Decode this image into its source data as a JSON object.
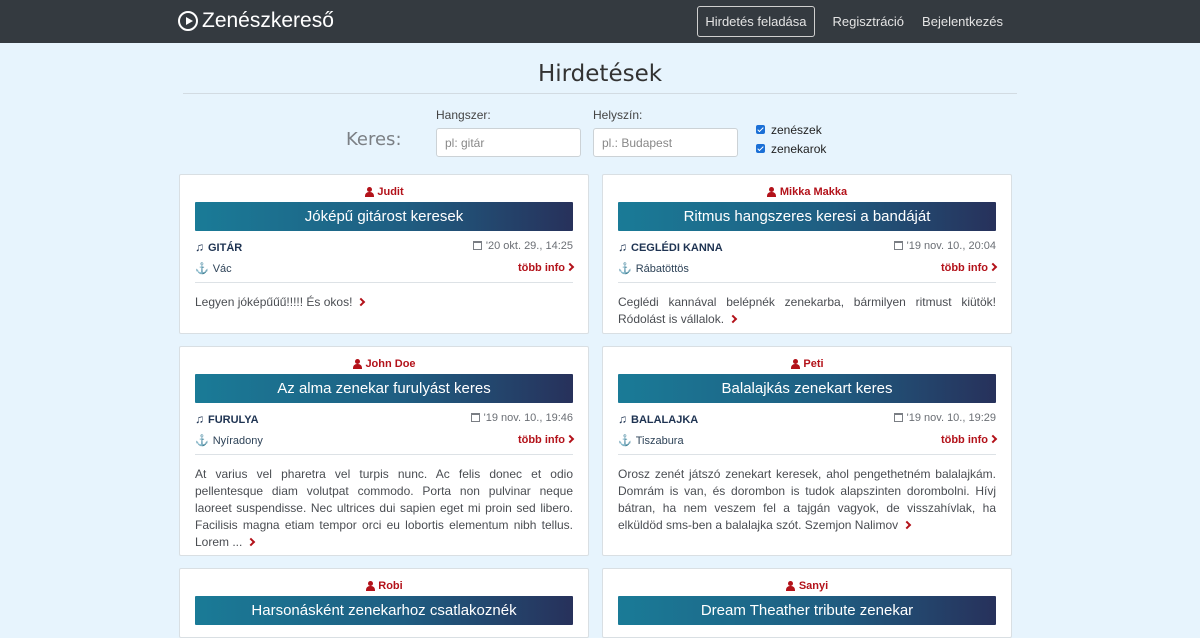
{
  "navbar": {
    "brand": "Zenészkereső",
    "links": [
      "Hirdetés feladása",
      "Regisztráció",
      "Bejelentkezés"
    ]
  },
  "page_title": "Hirdetések",
  "search": {
    "lead": "Keres:",
    "instrument_label": "Hangszer:",
    "instrument_placeholder": "pl: gitár",
    "location_label": "Helyszín:",
    "location_placeholder": "pl.: Budapest",
    "checkbox_musicians": "zenészek",
    "checkbox_bands": "zenekarok"
  },
  "cards": [
    {
      "author": "Judit",
      "title": "Jóképű gitárost keresek",
      "instrument": "GITÁR",
      "date": "'20 okt. 29., 14:25",
      "location": "Vác",
      "more": "több info",
      "description": "Legyen jóképűűű!!!!! És okos!"
    },
    {
      "author": "Mikka Makka",
      "title": "Ritmus hangszeres keresi a bandáját",
      "instrument": "CEGLÉDI KANNA",
      "date": "'19 nov. 10., 20:04",
      "location": "Rábatöttös",
      "more": "több info",
      "description": "Ceglédi kannával belépnék zenekarba, bármilyen ritmust kiütök! Ródolást is vállalok."
    },
    {
      "author": "John Doe",
      "title": "Az alma zenekar furulyást keres",
      "instrument": "FURULYA",
      "date": "'19 nov. 10., 19:46",
      "location": "Nyíradony",
      "more": "több info",
      "description": "At varius vel pharetra vel turpis nunc. Ac felis donec et odio pellentesque diam volutpat commodo. Porta non pulvinar neque laoreet suspendisse. Nec ultrices dui sapien eget mi proin sed libero. Facilisis magna etiam tempor orci eu lobortis elementum nibh tellus. Lorem ..."
    },
    {
      "author": "Peti",
      "title": "Balalajkás zenekart keres",
      "instrument": "BALALAJKA",
      "date": "'19 nov. 10., 19:29",
      "location": "Tiszabura",
      "more": "több info",
      "description": "Orosz zenét játszó zenekart keresek, ahol pengethetném balalajkám. Domrám is van, és dorombon is tudok alapszinten dorombolni. Hívj bátran, ha nem veszem fel a tajgán vagyok, de visszahívlak, ha elküldöd sms-ben a balalajka szót. Szemjon Nalimov"
    },
    {
      "author": "Robi",
      "title": "Harsonásként zenekarhoz csatlakoznék"
    },
    {
      "author": "Sanyi",
      "title": "Dream Theather tribute zenekar"
    }
  ]
}
